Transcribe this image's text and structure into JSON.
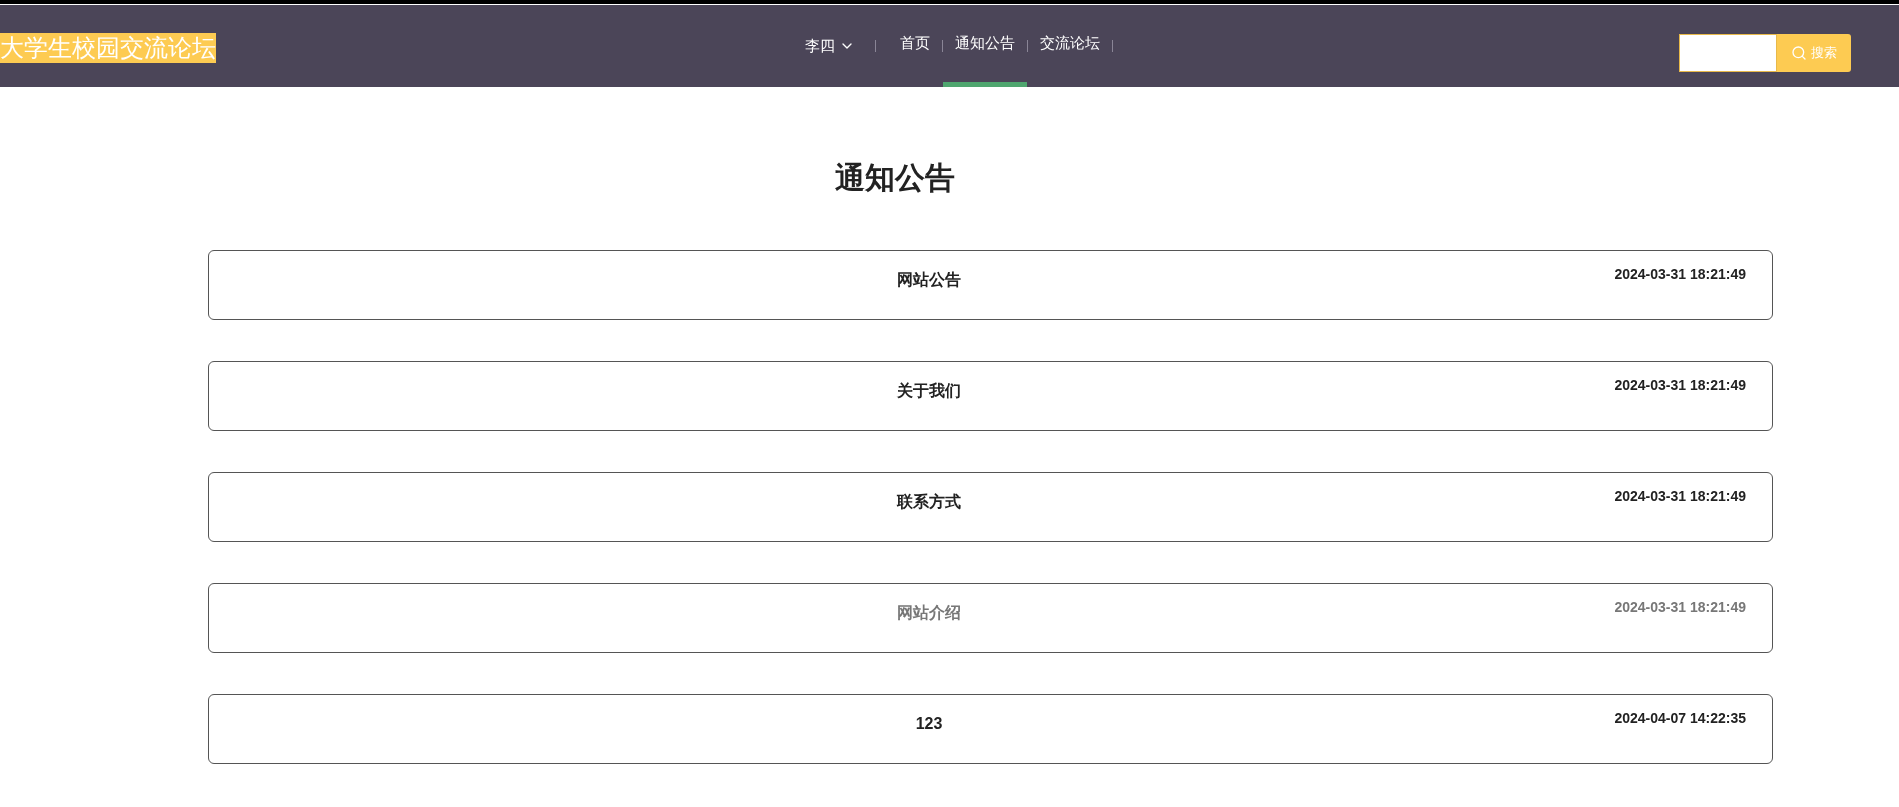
{
  "header": {
    "logo": "大学生校园交流论坛",
    "user_menu": "李四",
    "nav": [
      {
        "label": "首页",
        "selected": false
      },
      {
        "label": "通知公告",
        "selected": true
      },
      {
        "label": "交流论坛",
        "selected": false
      }
    ],
    "search": {
      "button": "搜索"
    }
  },
  "page_title": "通知公告",
  "notices": [
    {
      "title": "网站公告",
      "date": "2024-03-31 18:21:49",
      "hovered": false
    },
    {
      "title": "关于我们",
      "date": "2024-03-31 18:21:49",
      "hovered": false
    },
    {
      "title": "联系方式",
      "date": "2024-03-31 18:21:49",
      "hovered": false
    },
    {
      "title": "网站介绍",
      "date": "2024-03-31 18:21:49",
      "hovered": true
    },
    {
      "title": "123",
      "date": "2024-04-07 14:22:35",
      "hovered": false
    }
  ]
}
